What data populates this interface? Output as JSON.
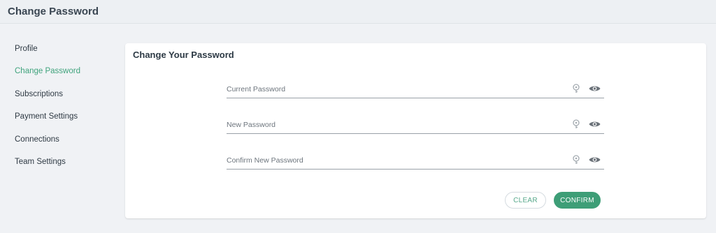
{
  "header": {
    "title": "Change Password"
  },
  "sidebar": {
    "items": [
      {
        "label": "Profile",
        "active": false
      },
      {
        "label": "Change Password",
        "active": true
      },
      {
        "label": "Subscriptions",
        "active": false
      },
      {
        "label": "Payment Settings",
        "active": false
      },
      {
        "label": "Connections",
        "active": false
      },
      {
        "label": "Team Settings",
        "active": false
      }
    ]
  },
  "card": {
    "title": "Change Your Password",
    "fields": [
      {
        "placeholder": "Current Password",
        "value": ""
      },
      {
        "placeholder": "New Password",
        "value": ""
      },
      {
        "placeholder": "Confirm New Password",
        "value": ""
      }
    ],
    "clear_label": "CLEAR",
    "confirm_label": "CONFIRM"
  },
  "icons": {
    "key": "key-icon",
    "eye": "eye-icon"
  },
  "colors": {
    "accent": "#3e9e77",
    "active_text": "#3fa37c"
  }
}
